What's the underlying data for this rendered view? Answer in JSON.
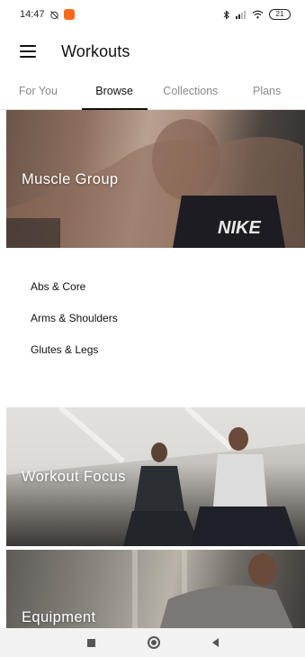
{
  "status_bar": {
    "time": "14:47",
    "battery": "21",
    "icons": [
      "alarm-off-icon",
      "app-notification-icon",
      "bluetooth-icon",
      "signal-icon",
      "wifi-icon",
      "battery-icon"
    ]
  },
  "app_bar": {
    "title": "Workouts",
    "menu_icon": "menu-icon"
  },
  "tabs": [
    {
      "label": "For You",
      "active": false
    },
    {
      "label": "Browse",
      "active": true
    },
    {
      "label": "Collections",
      "active": false
    },
    {
      "label": "Plans",
      "active": false
    }
  ],
  "sections": {
    "muscle_group": {
      "title": "Muscle Group",
      "items": [
        "Abs & Core",
        "Arms & Shoulders",
        "Glutes & Legs"
      ]
    },
    "workout_focus": {
      "title": "Workout Focus"
    },
    "equipment": {
      "title": "Equipment"
    }
  },
  "colors": {
    "accent": "#111111",
    "inactive_tab": "#8a8a8a",
    "app_badge": "#ff6a1a"
  }
}
